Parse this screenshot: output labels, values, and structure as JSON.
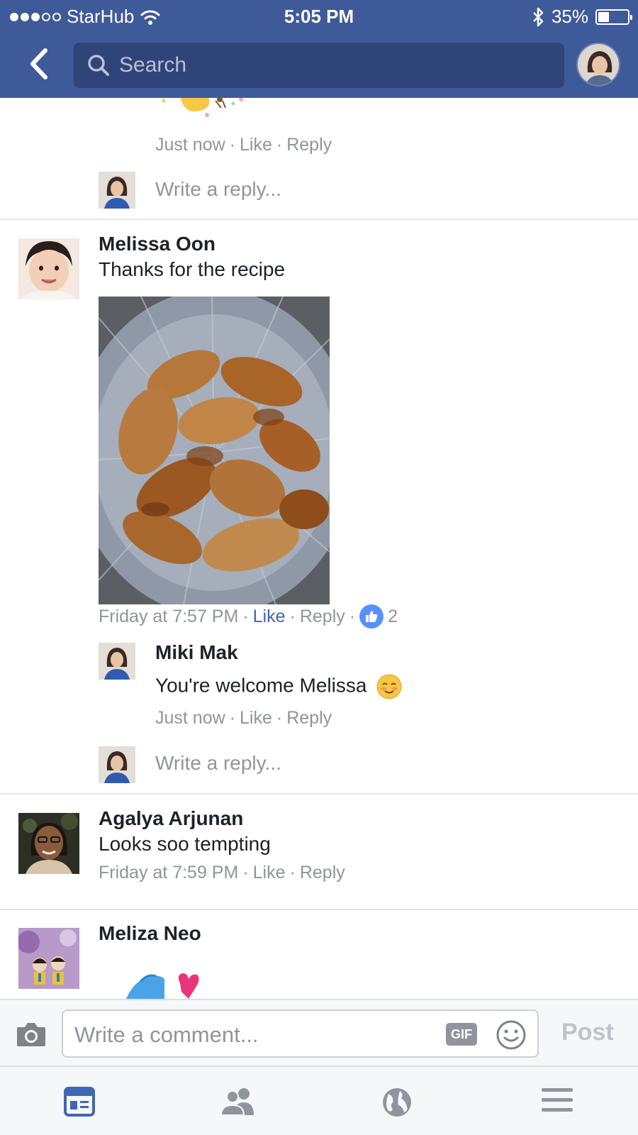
{
  "status_bar": {
    "carrier": "StarHub",
    "time": "5:05 PM",
    "battery": "35%",
    "battery_level": 0.35
  },
  "header": {
    "search_placeholder": "Search"
  },
  "comments": {
    "prev_reply_meta": {
      "time": "Just now",
      "like": "Like",
      "reply": "Reply"
    },
    "prev_write_reply": "Write a reply...",
    "melissa": {
      "name": "Melissa Oon",
      "text": "Thanks for the recipe",
      "time": "Friday at 7:57 PM",
      "like": "Like",
      "reply": "Reply",
      "like_count": "2",
      "reply_item": {
        "name": "Miki Mak",
        "text": "You're welcome Melissa",
        "time": "Just now",
        "like": "Like",
        "reply": "Reply"
      },
      "write_reply": "Write a reply..."
    },
    "agalya": {
      "name": "Agalya Arjunan",
      "text": "Looks soo tempting",
      "time": "Friday at 7:59 PM",
      "like": "Like",
      "reply": "Reply"
    },
    "meliza": {
      "name": "Meliza Neo"
    }
  },
  "composer": {
    "placeholder": "Write a comment...",
    "gif_label": "GIF",
    "post_label": "Post"
  },
  "colors": {
    "brand_blue": "#3f5a99",
    "link_blue": "#4267b2",
    "reaction_blue": "#5890ff"
  },
  "tab_icons": [
    "news-feed-icon",
    "friends-icon",
    "globe-icon",
    "menu-icon"
  ]
}
